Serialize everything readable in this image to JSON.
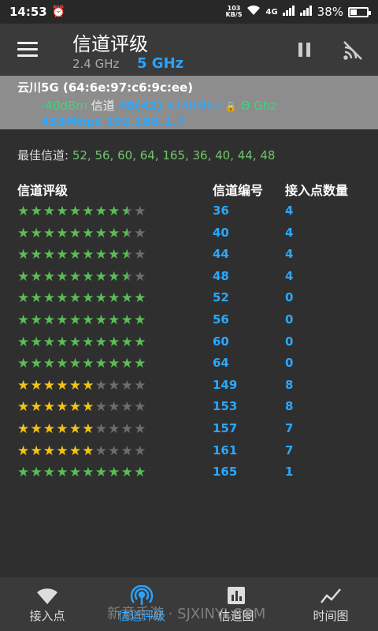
{
  "status": {
    "time": "14:53",
    "speed_top": "103",
    "speed_unit": "KB/S",
    "net": "4G",
    "battery": "38%",
    "battery_level": 0.38
  },
  "appbar": {
    "title": "信道评级",
    "band_24": "2.4 GHz",
    "band_5": "5 GHz"
  },
  "connected": {
    "ssid": "云川5G (64:6e:97:c6:9c:ee)",
    "dbm": "-40dBm",
    "channel_label": "信道",
    "channel": "48(42)",
    "freq": "5240MHz",
    "security": "Θ Ghz",
    "speed_ip": "433Mbps 192.168.1.7"
  },
  "best": {
    "label": "最佳信道:",
    "values": "52, 56, 60, 64, 165, 36, 40, 44, 48"
  },
  "table": {
    "col_rating": "信道评级",
    "col_channel": "信道编号",
    "col_count": "接入点数量",
    "rows": [
      {
        "rating": 8.5,
        "color": "green",
        "channel": "36",
        "count": "4"
      },
      {
        "rating": 8.5,
        "color": "green",
        "channel": "40",
        "count": "4"
      },
      {
        "rating": 8.5,
        "color": "green",
        "channel": "44",
        "count": "4"
      },
      {
        "rating": 8.5,
        "color": "green",
        "channel": "48",
        "count": "4"
      },
      {
        "rating": 10,
        "color": "green",
        "channel": "52",
        "count": "0"
      },
      {
        "rating": 10,
        "color": "green",
        "channel": "56",
        "count": "0"
      },
      {
        "rating": 10,
        "color": "green",
        "channel": "60",
        "count": "0"
      },
      {
        "rating": 10,
        "color": "green",
        "channel": "64",
        "count": "0"
      },
      {
        "rating": 6,
        "color": "yellow",
        "channel": "149",
        "count": "8"
      },
      {
        "rating": 6,
        "color": "yellow",
        "channel": "153",
        "count": "8"
      },
      {
        "rating": 6,
        "color": "yellow",
        "channel": "157",
        "count": "7"
      },
      {
        "rating": 6,
        "color": "yellow",
        "channel": "161",
        "count": "7"
      },
      {
        "rating": 10,
        "color": "green",
        "channel": "165",
        "count": "1"
      }
    ]
  },
  "nav": [
    {
      "label": "接入点",
      "icon": "wifi-icon"
    },
    {
      "label": "信道评级",
      "icon": "signal-rings-icon"
    },
    {
      "label": "信道图",
      "icon": "bar-chart-icon"
    },
    {
      "label": "时间图",
      "icon": "line-chart-icon"
    }
  ],
  "watermark": "新意手游 · SJXINYI.COM",
  "colors": {
    "accent": "#29a3ff",
    "star_green": "#5abd55",
    "star_yellow": "#f3c316"
  }
}
